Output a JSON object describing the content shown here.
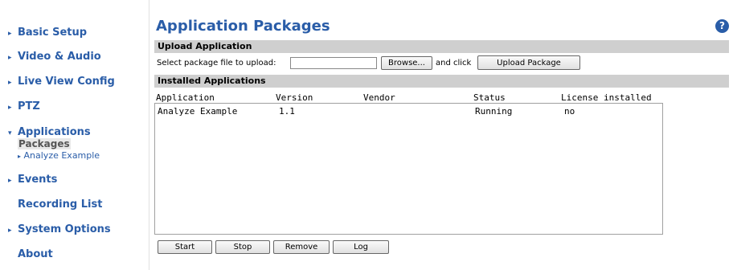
{
  "sidebar": {
    "items": [
      {
        "label": "Basic Setup",
        "arrow": "▸"
      },
      {
        "label": "Video & Audio",
        "arrow": "▸"
      },
      {
        "label": "Live View Config",
        "arrow": "▸"
      },
      {
        "label": "PTZ",
        "arrow": "▸"
      },
      {
        "label": "Applications",
        "arrow": "▾"
      },
      {
        "label": "Events",
        "arrow": "▸"
      },
      {
        "label": "Recording List",
        "arrow": ""
      },
      {
        "label": "System Options",
        "arrow": "▸"
      },
      {
        "label": "About",
        "arrow": ""
      }
    ],
    "sub_packages": "Packages",
    "sub_analyze": "Analyze Example",
    "sub_arrow": "▸"
  },
  "main": {
    "title": "Application Packages",
    "help_icon": "?",
    "upload_section": "Upload Application",
    "select_label": "Select package file to upload:",
    "file_value": "",
    "browse_label": "Browse...",
    "and_click": "and click",
    "upload_button": "Upload Package",
    "installed_section": "Installed Applications",
    "columns": [
      "Application",
      "Version",
      "Vendor",
      "Status",
      "License installed"
    ],
    "rows": [
      {
        "application": "Analyze Example",
        "version": "1.1",
        "vendor": "",
        "status": "Running",
        "license": "no"
      }
    ],
    "buttons": {
      "start": "Start",
      "stop": "Stop",
      "remove": "Remove",
      "log": "Log"
    }
  },
  "colors": {
    "link": "#2a5da8",
    "section_bar": "#cfcfcf"
  }
}
